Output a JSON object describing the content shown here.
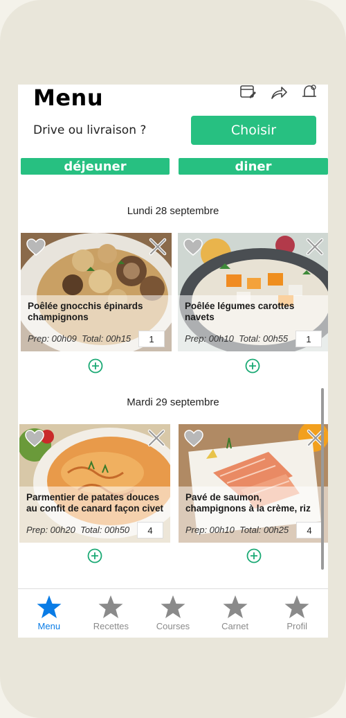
{
  "header": {
    "title": "Menu",
    "icons": [
      "calendar-edit-icon",
      "share-icon",
      "alarm-icon"
    ]
  },
  "delivery": {
    "label": "Drive ou livraison ?",
    "button": "Choisir"
  },
  "meal_tabs": [
    "déjeuner",
    "diner"
  ],
  "days": [
    {
      "title": "Lundi 28 septembre",
      "recipes": [
        {
          "name": "Poêlée gnocchis épinards champignons",
          "prep": "Prep: 00h09",
          "total": "Total: 00h15",
          "qty": "1"
        },
        {
          "name": "Poêlée légumes carottes navets",
          "prep": "Prep: 00h10",
          "total": "Total: 00h55",
          "qty": "1"
        }
      ]
    },
    {
      "title": "Mardi 29 septembre",
      "recipes": [
        {
          "name": "Parmentier de patates douces au confit de canard façon civet",
          "prep": "Prep: 00h20",
          "total": "Total: 00h50",
          "qty": "4"
        },
        {
          "name": "Pavé de saumon, champignons à la crème, riz",
          "prep": "Prep: 00h10",
          "total": "Total: 00h25",
          "qty": "4"
        }
      ]
    }
  ],
  "tabbar": [
    {
      "label": "Menu",
      "active": true
    },
    {
      "label": "Recettes"
    },
    {
      "label": "Courses"
    },
    {
      "label": "Carnet"
    },
    {
      "label": "Profil"
    }
  ],
  "colors": {
    "accent": "#27c081",
    "active_tab": "#0a7ce6",
    "inactive_tab": "#8a8a8a"
  }
}
